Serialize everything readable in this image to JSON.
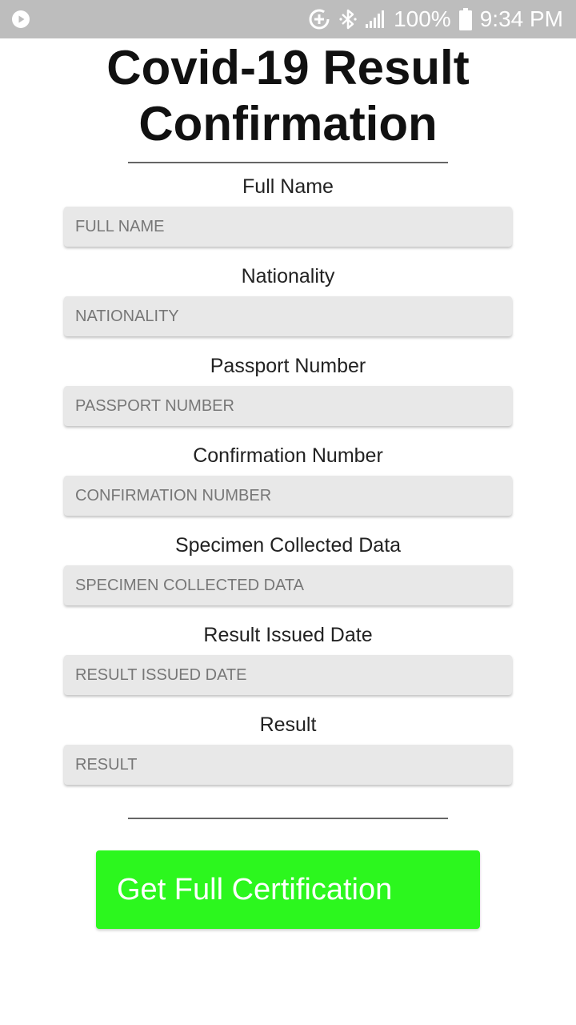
{
  "status_bar": {
    "battery": "100%",
    "time": "9:34 PM"
  },
  "page": {
    "title_line1": "Covid-19 Result",
    "title_line2": "Confirmation"
  },
  "form": {
    "fields": [
      {
        "label": "Full Name",
        "placeholder": "FULL NAME",
        "value": ""
      },
      {
        "label": "Nationality",
        "placeholder": "NATIONALITY",
        "value": ""
      },
      {
        "label": "Passport Number",
        "placeholder": "PASSPORT NUMBER",
        "value": ""
      },
      {
        "label": "Confirmation Number",
        "placeholder": "CONFIRMATION NUMBER",
        "value": ""
      },
      {
        "label": "Specimen Collected Data",
        "placeholder": "SPECIMEN COLLECTED DATA",
        "value": ""
      },
      {
        "label": "Result Issued Date",
        "placeholder": "RESULT ISSUED DATE",
        "value": ""
      },
      {
        "label": "Result",
        "placeholder": "RESULT",
        "value": ""
      }
    ],
    "submit_label": "Get Full Certification"
  },
  "colors": {
    "status_bar_bg": "#bdbdbd",
    "button_bg": "#2cf71e",
    "input_bg": "#e8e8e8"
  }
}
